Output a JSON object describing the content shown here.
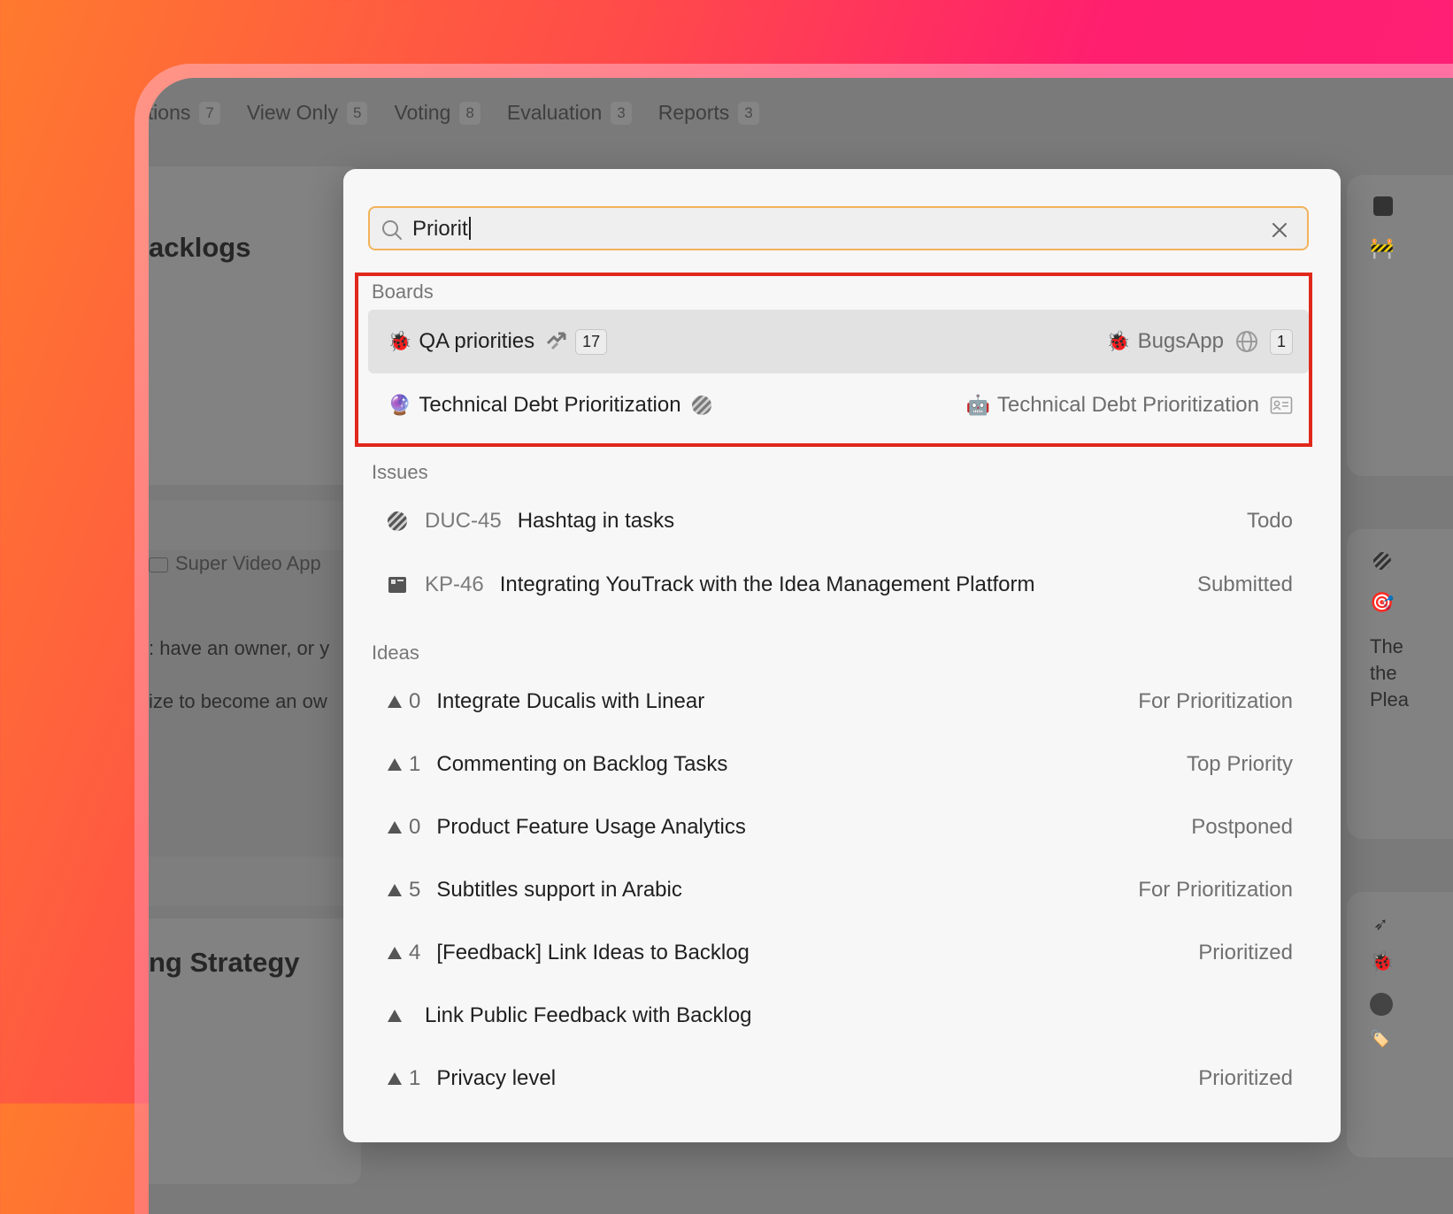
{
  "background": {
    "tabs": [
      {
        "label": "ations",
        "count": "7"
      },
      {
        "label": "View Only",
        "count": "5"
      },
      {
        "label": "Voting",
        "count": "8"
      },
      {
        "label": "Evaluation",
        "count": "3"
      },
      {
        "label": "Reports",
        "count": "3"
      }
    ],
    "left_title_1": "acklogs",
    "left_title_2": "ng Strategy",
    "left_app_label": "Super Video App",
    "left_text_1": ": have an owner, or y",
    "left_text_2": "ize to become an ow",
    "right_text_1": "The",
    "right_text_2": "the",
    "right_text_3": "Plea"
  },
  "search": {
    "value": "Priorit",
    "icon": "search-icon",
    "clear_icon": "close-icon"
  },
  "boards": {
    "label": "Boards",
    "items": [
      {
        "icon": "🐞",
        "title": "QA priorities",
        "type_icon": "jira-icon",
        "count": "17",
        "app_icon": "🐞",
        "app": "BugsApp",
        "visibility_icon": "globe-icon",
        "app_count": "1"
      },
      {
        "icon": "🔮",
        "title": "Technical Debt Prioritization",
        "type_icon": "linear-icon",
        "app_icon": "🤖",
        "app": "Technical Debt Prioritization",
        "visibility_icon": "id-card-icon"
      }
    ]
  },
  "issues": {
    "label": "Issues",
    "items": [
      {
        "icon": "linear-icon",
        "id": "DUC-45",
        "title": "Hashtag in tasks",
        "status": "Todo"
      },
      {
        "icon": "board-icon",
        "id": "KP-46",
        "title": "Integrating YouTrack with the Idea Management Platform",
        "status": "Submitted"
      }
    ]
  },
  "ideas": {
    "label": "Ideas",
    "items": [
      {
        "votes": "0",
        "title": "Integrate Ducalis with Linear",
        "status": "For Prioritization"
      },
      {
        "votes": "1",
        "title": "Commenting on Backlog Tasks",
        "status": "Top Priority"
      },
      {
        "votes": "0",
        "title": "Product Feature Usage Analytics",
        "status": "Postponed"
      },
      {
        "votes": "5",
        "title": "Subtitles support in Arabic",
        "status": "For Prioritization"
      },
      {
        "votes": "4",
        "title": "[Feedback] Link Ideas to Backlog",
        "status": "Prioritized"
      },
      {
        "votes": "",
        "title": "Link Public Feedback with Backlog",
        "status": ""
      },
      {
        "votes": "1",
        "title": "Privacy level",
        "status": "Prioritized"
      }
    ]
  },
  "colors": {
    "accent_border": "#f2b35c",
    "highlight": "#e0281b"
  }
}
